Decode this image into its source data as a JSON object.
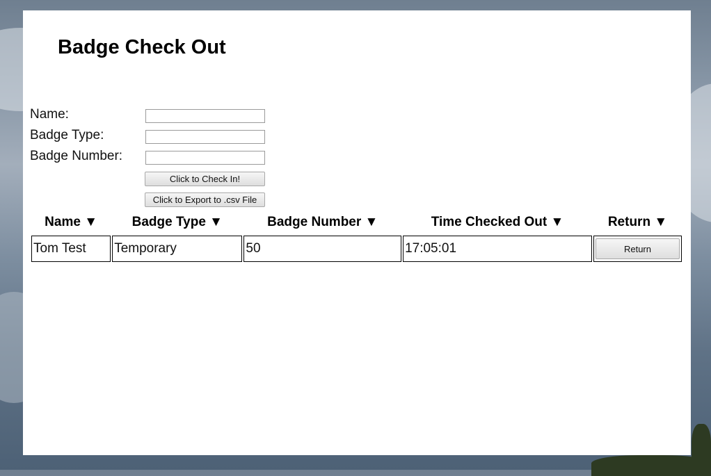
{
  "page": {
    "title": "Badge Check Out"
  },
  "form": {
    "name_label": "Name:",
    "badge_type_label": "Badge Type:",
    "badge_number_label": "Badge Number:",
    "name_value": "",
    "badge_type_value": "",
    "badge_number_value": "",
    "check_in_button": "Click to Check In!",
    "export_button": "Click to Export to .csv File"
  },
  "table": {
    "columns": [
      "Name ▼",
      "Badge Type ▼",
      "Badge Number ▼",
      "Time Checked Out ▼",
      "Return ▼"
    ],
    "rows": [
      {
        "name": "Tom Test",
        "badge_type": "Temporary",
        "badge_number": "50",
        "time_checked_out": "17:05:01",
        "return_label": "Return"
      }
    ]
  },
  "colors": {
    "panel": "#ffffff",
    "text": "#000000",
    "button": "#e6e6e6"
  }
}
